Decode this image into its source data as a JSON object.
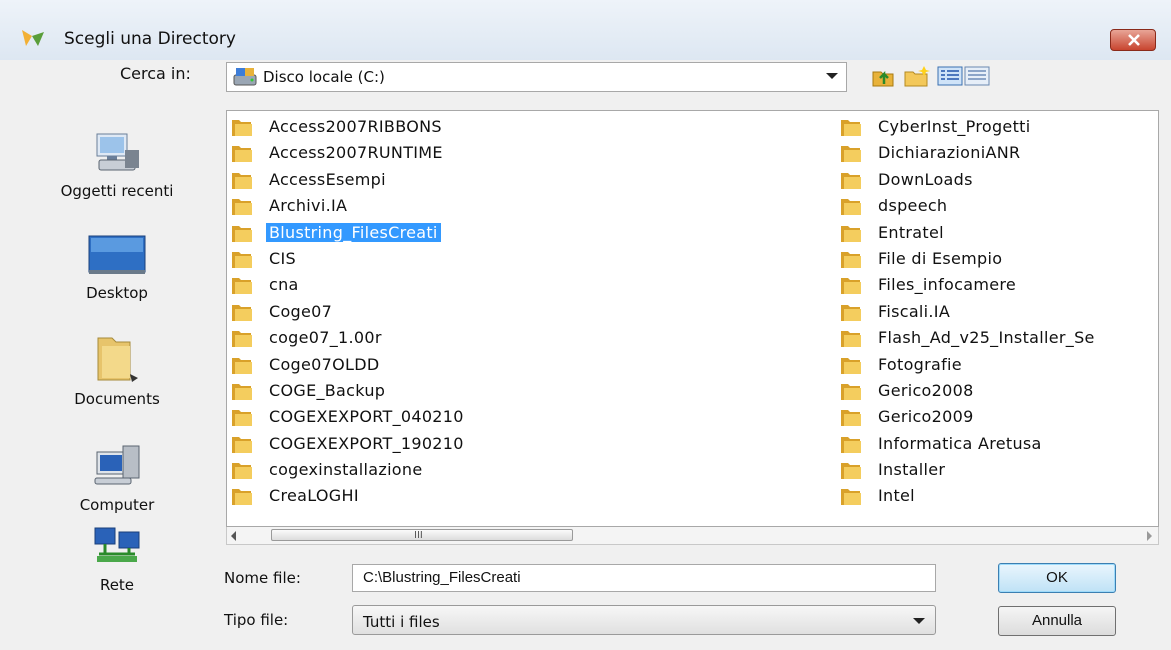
{
  "window": {
    "title": "Scegli una Directory"
  },
  "lookin": {
    "label": "Cerca in:",
    "value": "Disco locale (C:)"
  },
  "places": [
    {
      "label": "Oggetti recenti",
      "icon": "recent-items-icon"
    },
    {
      "label": "Desktop",
      "icon": "desktop-icon"
    },
    {
      "label": "Documents",
      "icon": "documents-folder-icon"
    },
    {
      "label": "Computer",
      "icon": "computer-icon"
    },
    {
      "label": "Rete",
      "icon": "network-icon"
    }
  ],
  "files": {
    "col1": [
      "Access2007RIBBONS",
      "Access2007RUNTIME",
      "AccessEsempi",
      "Archivi.IA",
      "Blustring_FilesCreati",
      "CIS",
      "cna",
      "Coge07",
      "coge07_1.00r",
      "Coge07OLDD",
      "COGE_Backup",
      "COGEXEXPORT_040210",
      "COGEXEXPORT_190210",
      "cogexinstallazione",
      "CreaLOGHI"
    ],
    "col2": [
      "CyberInst_Progetti",
      "DichiarazioniANR",
      "DownLoads",
      "dspeech",
      "Entratel",
      "File di Esempio",
      "Files_infocamere",
      "Fiscali.IA",
      "Flash_Ad_v25_Installer_Se",
      "Fotografie",
      "Gerico2008",
      "Gerico2009",
      "Informatica Aretusa",
      "Installer",
      "Intel"
    ],
    "selected": "Blustring_FilesCreati"
  },
  "filename": {
    "label": "Nome file:",
    "value": "C:\\Blustring_FilesCreati"
  },
  "filetype": {
    "label": "Tipo file:",
    "value": "Tutti i files"
  },
  "buttons": {
    "ok": "OK",
    "cancel": "Annulla"
  },
  "scrollbar": {
    "grip": "III"
  },
  "colors": {
    "selection": "#3399ff",
    "folder": "#e8b23a"
  }
}
